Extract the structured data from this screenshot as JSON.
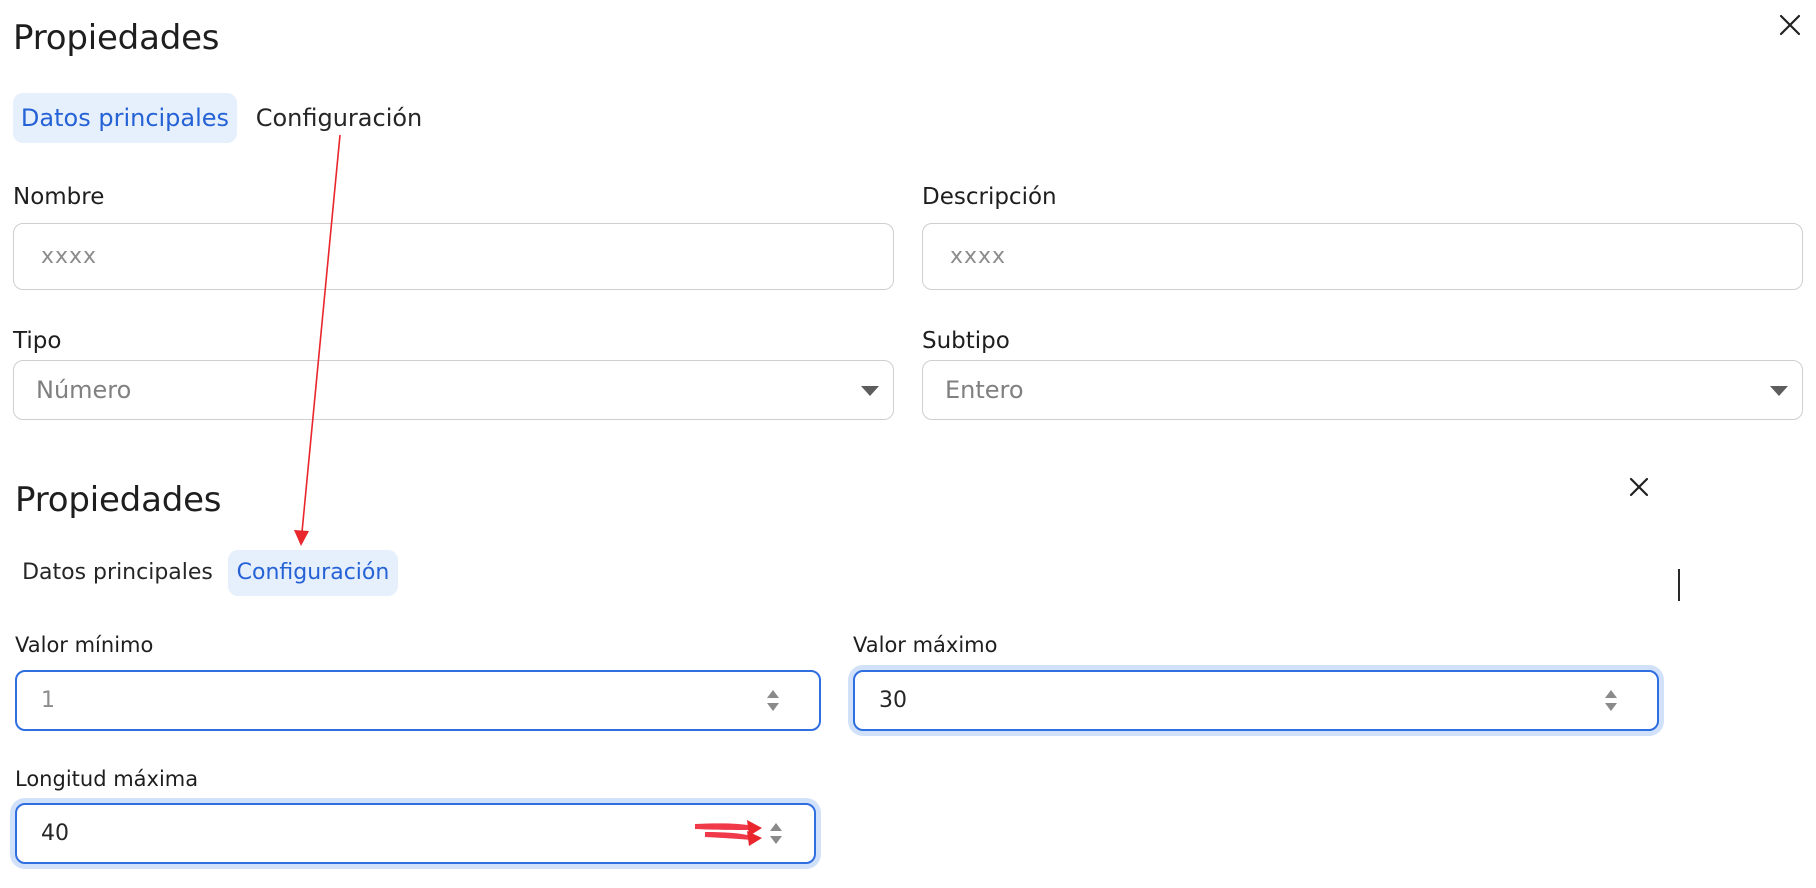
{
  "colors": {
    "accent": "#2562d6",
    "tab_active_bg": "#e6effc",
    "focus_border": "#2f6fe0",
    "annotation_red": "#e8262c"
  },
  "top_panel": {
    "title": "Propiedades",
    "close_icon": "close-icon",
    "tabs": [
      {
        "label": "Datos principales",
        "active": true
      },
      {
        "label": "Configuración",
        "active": false
      }
    ],
    "fields": {
      "nombre": {
        "label": "Nombre",
        "placeholder": "xxxx"
      },
      "descripcion": {
        "label": "Descripción",
        "placeholder": "xxxx"
      },
      "tipo": {
        "label": "Tipo",
        "selected": "Número",
        "icon": "chevron-down-icon"
      },
      "subtipo": {
        "label": "Subtipo",
        "selected": "Entero",
        "icon": "chevron-down-icon"
      }
    }
  },
  "bottom_panel": {
    "title": "Propiedades",
    "close_icon": "close-icon",
    "tabs": [
      {
        "label": "Datos principales",
        "active": false
      },
      {
        "label": "Configuración",
        "active": true
      }
    ],
    "fields": {
      "valor_minimo": {
        "label": "Valor mínimo",
        "value": "1"
      },
      "valor_maximo": {
        "label": "Valor máximo",
        "value": "30"
      },
      "longitud_maxima": {
        "label": "Longitud máxima",
        "value": "40"
      }
    }
  },
  "annotations": {
    "arrow_1": "from Configuración tab (top) to Configuración tab (bottom)",
    "arrow_2": "pointing at Longitud máxima stepper"
  }
}
